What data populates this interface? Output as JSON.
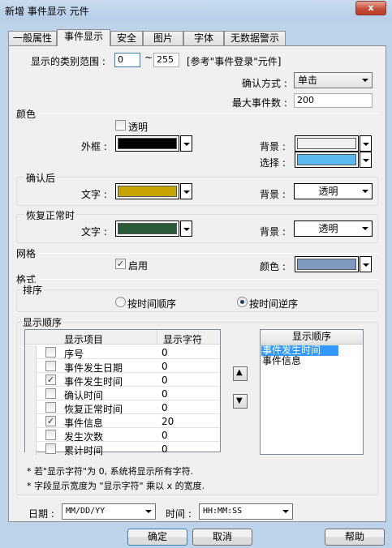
{
  "window": {
    "title": "新增 事件显示 元件",
    "close": "x"
  },
  "tabs": [
    {
      "label": "一般属性"
    },
    {
      "label": "事件显示"
    },
    {
      "label": "安全"
    },
    {
      "label": "图片"
    },
    {
      "label": "字体"
    },
    {
      "label": "无数据警示"
    }
  ],
  "category": {
    "label": "显示的类别范围 :",
    "from": "0",
    "tilde": "~",
    "to": "255",
    "note": "[参考\"事件登录\"元件]"
  },
  "confirm_mode": {
    "label": "确认方式 :",
    "value": "单击"
  },
  "max_events": {
    "label": "最大事件数 :",
    "value": "200"
  },
  "color": {
    "title": "颜色",
    "transparent_label": "透明",
    "frame_label": "外框 :",
    "frame_color": "#000000",
    "bg_label": "背景 :",
    "bg_color": "#f0f0f0",
    "select_label": "选择 :",
    "select_color": "#5cb9f0"
  },
  "after_confirm": {
    "title": "确认后",
    "text_label": "文字 :",
    "text_color": "#c8a400",
    "bg_label": "背景 :",
    "bg_value": "透明"
  },
  "restore_normal": {
    "title": "恢复正常时",
    "text_label": "文字 :",
    "text_color": "#2a5a3a",
    "bg_label": "背景 :",
    "bg_value": "透明"
  },
  "grid": {
    "title": "网格",
    "enable_label": "启用",
    "enabled": "✓",
    "color_label": "颜色 :",
    "color": "#7d99c0"
  },
  "format": {
    "title": "格式"
  },
  "sort": {
    "title": "排序",
    "option_asc": "按时间顺序",
    "option_desc": "按时间逆序"
  },
  "display_order": {
    "title": "显示顺序",
    "col_item": "显示项目",
    "col_chars": "显示字符",
    "rows": [
      {
        "name": "序号",
        "chars": "0",
        "checked": ""
      },
      {
        "name": "事件发生日期",
        "chars": "0",
        "checked": ""
      },
      {
        "name": "事件发生时间",
        "chars": "0",
        "checked": "✓"
      },
      {
        "name": "确认时间",
        "chars": "0",
        "checked": ""
      },
      {
        "name": "恢复正常时间",
        "chars": "0",
        "checked": ""
      },
      {
        "name": "事件信息",
        "chars": "20",
        "checked": "✓"
      },
      {
        "name": "发生次数",
        "chars": "0",
        "checked": ""
      },
      {
        "name": "累计时间",
        "chars": "0",
        "checked": ""
      }
    ],
    "list_header": "显示顺序",
    "list_items": [
      "事件发生时间",
      "事件信息"
    ],
    "up_icon": "▲",
    "down_icon": "▼",
    "note1": "* 若\"显示字符\"为 0, 系统将显示所有字符.",
    "note2": "* 字段显示宽度为 \"显示字符\" 乘以 x 的宽度."
  },
  "date": {
    "label": "日期 :",
    "value": "MM/DD/YY"
  },
  "time": {
    "label": "时间 :",
    "value": "HH:MM:SS"
  },
  "buttons": {
    "ok": "确定",
    "cancel": "取消",
    "help": "帮助"
  }
}
